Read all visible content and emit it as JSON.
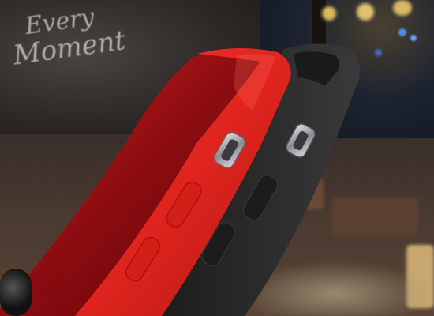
{
  "scene": {
    "sign_text": [
      "Every",
      "Moment"
    ],
    "colors": {
      "red_case": "#e0241e",
      "red_case_edge": "#a8120f",
      "black_case": "#262626",
      "metal": "#b8b8bc"
    }
  }
}
